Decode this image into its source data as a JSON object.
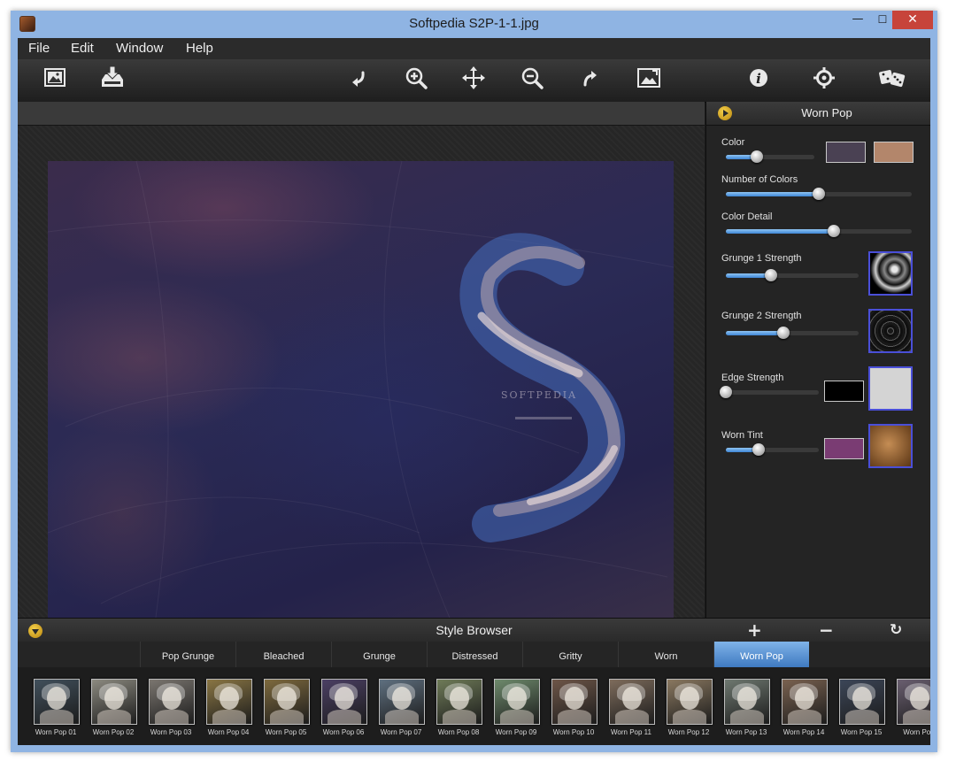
{
  "window": {
    "title": "Softpedia S2P-1-1.jpg",
    "minimize": "—",
    "maximize": "☐",
    "close": "✕"
  },
  "menu": [
    "File",
    "Edit",
    "Window",
    "Help"
  ],
  "toolbar": {
    "icons": [
      "open-image-icon",
      "save-icon",
      "undo-icon",
      "zoom-in-icon",
      "pan-icon",
      "zoom-out-icon",
      "redo-icon",
      "fit-image-icon",
      "info-icon",
      "settings-icon",
      "randomize-dice-icon"
    ]
  },
  "panel": {
    "title": "Worn Pop",
    "controls": [
      {
        "label": "Color",
        "value": 0.35,
        "swatches": [
          "#4a4153",
          "#b3866b"
        ]
      },
      {
        "label": "Number of Colors",
        "value": 0.5
      },
      {
        "label": "Color Detail",
        "value": 0.58
      },
      {
        "label": "Grunge 1 Strength",
        "value": 0.34,
        "texture": "grunge-1"
      },
      {
        "label": "Grunge 2 Strength",
        "value": 0.43,
        "texture": "grunge-2"
      },
      {
        "label": "Edge Strength",
        "value": 0.0,
        "swatches": [
          "#000000"
        ],
        "texture_color": "#d4d4d4"
      },
      {
        "label": "Worn Tint",
        "value": 0.35,
        "swatches": [
          "#7a3c73"
        ],
        "texture": "paper"
      }
    ]
  },
  "style_browser": {
    "title": "Style Browser",
    "add": "+",
    "remove": "−",
    "refresh": "↻",
    "tabs": [
      "Pop Grunge",
      "Bleached",
      "Grunge",
      "Distressed",
      "Gritty",
      "Worn",
      "Worn Pop"
    ],
    "active_tab": "Worn Pop",
    "thumbnails": [
      "Worn Pop 01",
      "Worn Pop 02",
      "Worn Pop 03",
      "Worn Pop 04",
      "Worn Pop 05",
      "Worn Pop 06",
      "Worn Pop 07",
      "Worn Pop 08",
      "Worn Pop 09",
      "Worn Pop 10",
      "Worn Pop 11",
      "Worn Pop 12",
      "Worn Pop 13",
      "Worn Pop 14",
      "Worn Pop 15",
      "Worn Pop"
    ],
    "thumb_tints": [
      "#41505c",
      "#8c8a80",
      "#7b7670",
      "#8a7644",
      "#7e6a3e",
      "#4b3f64",
      "#5f7080",
      "#6f7b58",
      "#6e8a6c",
      "#6e5648",
      "#7e6c5c",
      "#8a7860",
      "#6e7870",
      "#7a6250",
      "#3c4658",
      "#6a5f70"
    ]
  },
  "colors": {
    "accent": "#3e86d6",
    "window_frame": "#8fb4e3",
    "close": "#c7443a",
    "gold": "#f4d04a"
  }
}
